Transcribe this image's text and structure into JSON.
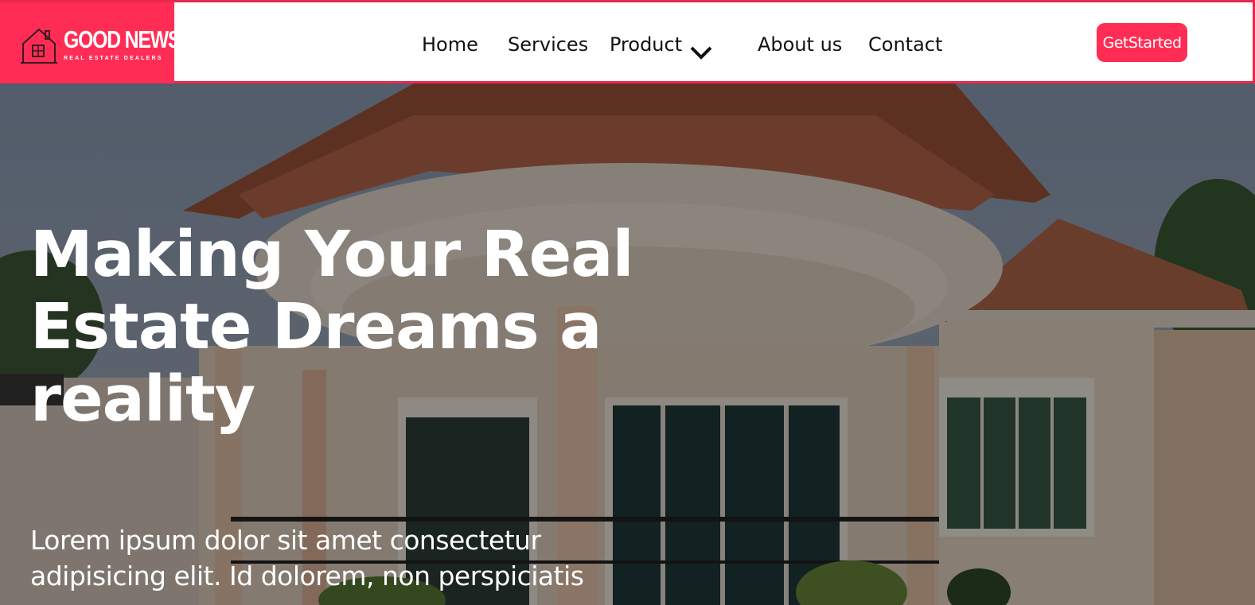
{
  "brand": {
    "name": "GOOD NEWS",
    "tagline": "REAL ESTATE DEALERS",
    "logo_icon": "house-icon",
    "accent_color": "#ff2d55"
  },
  "nav": {
    "items": [
      {
        "label": "Home"
      },
      {
        "label": "Services"
      },
      {
        "label": "Product",
        "icon": "chevron-down-icon"
      },
      {
        "label": "About us"
      },
      {
        "label": "Contact"
      }
    ]
  },
  "cta": {
    "label": "GetStarted"
  },
  "hero": {
    "headline": "Making Your Real Estate Dreams a reality",
    "body": "Lorem ipsum dolor sit amet consectetur adipisicing elit. Id dolorem, non perspiciatis",
    "background": "house-photo"
  }
}
